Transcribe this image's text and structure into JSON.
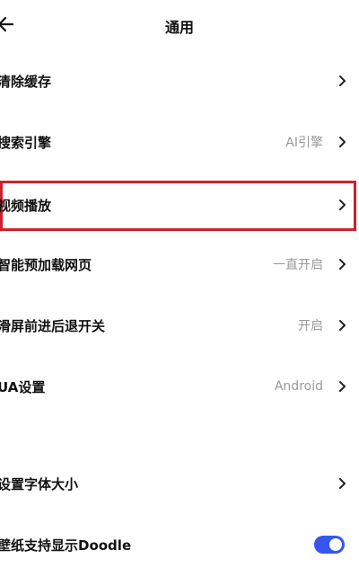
{
  "header": {
    "title": "通用",
    "back_icon": "arrow-left-icon"
  },
  "settings": [
    {
      "label": "清除缓存",
      "value": "",
      "control": "chevron"
    },
    {
      "label": "搜索引擎",
      "value": "AI引擎",
      "control": "chevron"
    },
    {
      "label": "视频播放",
      "value": "",
      "control": "chevron",
      "highlighted": true
    },
    {
      "label": "智能预加载网页",
      "value": "一直开启",
      "control": "chevron"
    },
    {
      "label": "滑屏前进后退开关",
      "value": "开启",
      "control": "chevron"
    },
    {
      "label": "UA设置",
      "value": "Android",
      "control": "chevron"
    },
    {
      "label": "设置字体大小",
      "value": "",
      "control": "chevron"
    },
    {
      "label": "壁纸支持显示Doodle",
      "value": "",
      "control": "toggle",
      "toggle_on": true
    }
  ],
  "colors": {
    "highlight_border": "#d0202c",
    "toggle_on": "#3556f0",
    "value_text": "#9a9a9a"
  }
}
